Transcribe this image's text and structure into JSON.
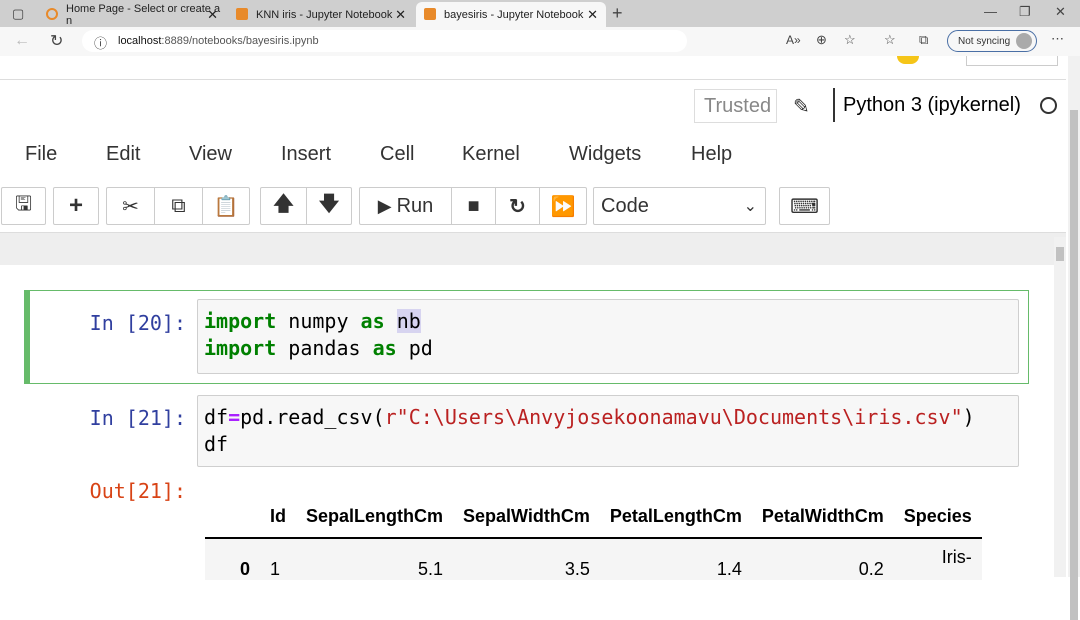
{
  "browser": {
    "tabs": [
      {
        "title": "Home Page - Select or create a n",
        "active": false
      },
      {
        "title": "KNN iris - Jupyter Notebook",
        "active": false
      },
      {
        "title": "bayesiris - Jupyter Notebook",
        "active": true
      }
    ],
    "url_host": "localhost",
    "url_rest": ":8889/notebooks/bayesiris.ipynb",
    "sync_label": "Not syncing"
  },
  "jupyter": {
    "trusted": "Trusted",
    "kernel": "Python 3 (ipykernel)",
    "menu": [
      "File",
      "Edit",
      "View",
      "Insert",
      "Cell",
      "Kernel",
      "Widgets",
      "Help"
    ],
    "run_label": "Run",
    "cell_type": "Code",
    "accent": "#66bb6a"
  },
  "cells": [
    {
      "prompt": "In [20]:",
      "lines": [
        [
          "import",
          " numpy ",
          "as",
          " ",
          "nb"
        ],
        [
          "import",
          " pandas ",
          "as",
          " pd"
        ]
      ]
    },
    {
      "prompt": "In [21]:",
      "l1a": "df",
      "l1op": "=",
      "l1b": "pd.read_csv(",
      "l1str": "r\"C:\\Users\\Anvyjosekoonamavu\\Documents\\iris.csv\"",
      "l1c": ")",
      "l2": "df"
    }
  ],
  "output": {
    "prompt": "Out[21]:",
    "columns": [
      "",
      "Id",
      "SepalLengthCm",
      "SepalWidthCm",
      "PetalLengthCm",
      "PetalWidthCm",
      "Species"
    ],
    "rows": [
      [
        "0",
        "1",
        "5.1",
        "3.5",
        "1.4",
        "0.2",
        "Iris-"
      ]
    ]
  }
}
